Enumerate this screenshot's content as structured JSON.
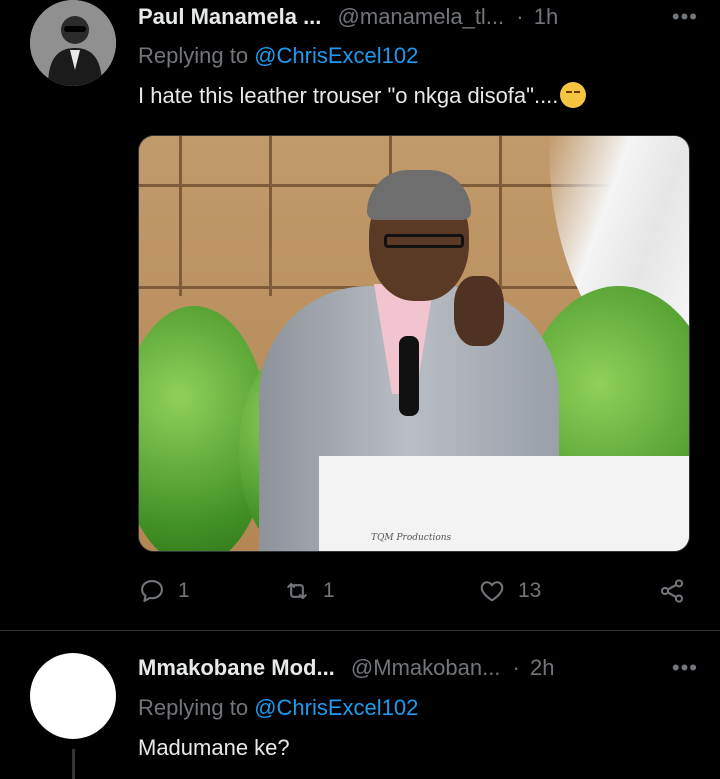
{
  "tweets": [
    {
      "display_name": "Paul Manamela ...",
      "handle": "@manamela_tl...",
      "separator": "·",
      "time": "1h",
      "more": "•••",
      "replying_prefix": "Replying to",
      "replying_to": "@ChrisExcel102",
      "text": "I hate this leather trouser \"o nkga disofa\"....",
      "media_watermark": "TQM Productions",
      "replies": "1",
      "retweets": "1",
      "likes": "13"
    },
    {
      "display_name": "Mmakobane Mod...",
      "handle": "@Mmakoban...",
      "separator": "·",
      "time": "2h",
      "more": "•••",
      "replying_prefix": "Replying to",
      "replying_to": "@ChrisExcel102",
      "text": "Madumane ke?"
    }
  ],
  "icons": {
    "reply": "reply-icon",
    "retweet": "retweet-icon",
    "like": "heart-icon",
    "share": "share-icon",
    "emoji": "smirking-face-emoji"
  },
  "colors": {
    "background": "#000000",
    "text_primary": "#e7e9ea",
    "text_secondary": "#71767b",
    "link": "#1d9bf0"
  }
}
